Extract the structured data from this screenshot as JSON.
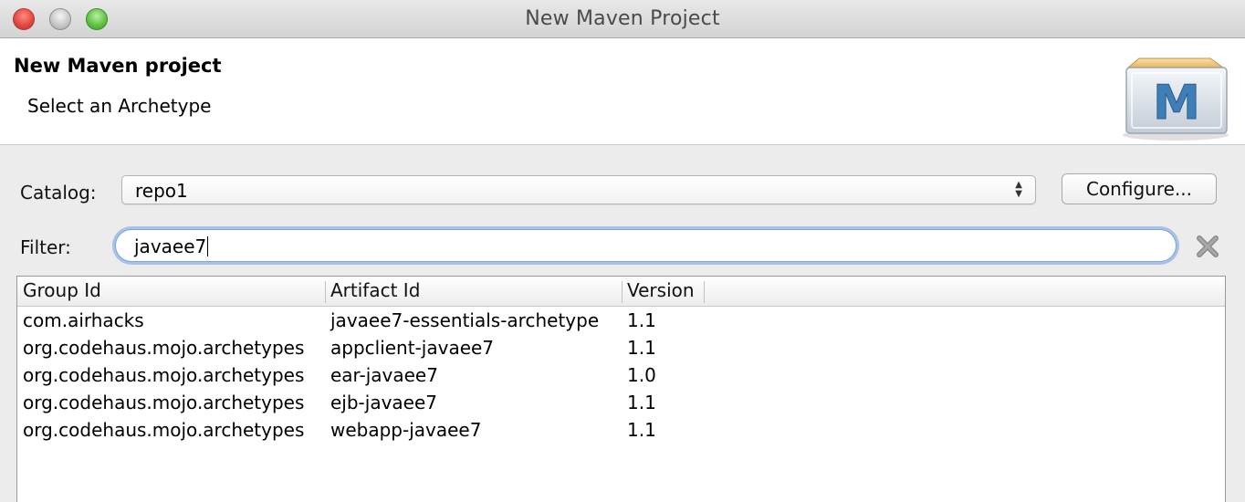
{
  "window": {
    "title": "New Maven Project"
  },
  "banner": {
    "title": "New Maven project",
    "subtitle": "Select an Archetype",
    "logo_letter": "M"
  },
  "catalog": {
    "label": "Catalog:",
    "value": "repo1"
  },
  "configure_button": {
    "label": "Configure..."
  },
  "filter": {
    "label": "Filter:",
    "value": "javaee7"
  },
  "table": {
    "columns": [
      "Group Id",
      "Artifact Id",
      "Version"
    ],
    "rows": [
      {
        "group_id": "com.airhacks",
        "artifact_id": "javaee7-essentials-archetype",
        "version": "1.1"
      },
      {
        "group_id": "org.codehaus.mojo.archetypes",
        "artifact_id": "appclient-javaee7",
        "version": "1.1"
      },
      {
        "group_id": "org.codehaus.mojo.archetypes",
        "artifact_id": "ear-javaee7",
        "version": "1.0"
      },
      {
        "group_id": "org.codehaus.mojo.archetypes",
        "artifact_id": "ejb-javaee7",
        "version": "1.1"
      },
      {
        "group_id": "org.codehaus.mojo.archetypes",
        "artifact_id": "webapp-javaee7",
        "version": "1.1"
      }
    ]
  },
  "icons": {
    "close": "close-window-icon",
    "minimize": "minimize-window-icon",
    "maximize": "zoom-window-icon",
    "clear": "clear-filter-icon",
    "logo": "maven-logo-icon",
    "select_arrows": "up-down-arrows-icon"
  },
  "colors": {
    "window_close": "#e0443e",
    "window_zoom": "#5cbf3e",
    "focus_ring": "#70a0e0",
    "logo_blue": "#3f7fb8"
  }
}
